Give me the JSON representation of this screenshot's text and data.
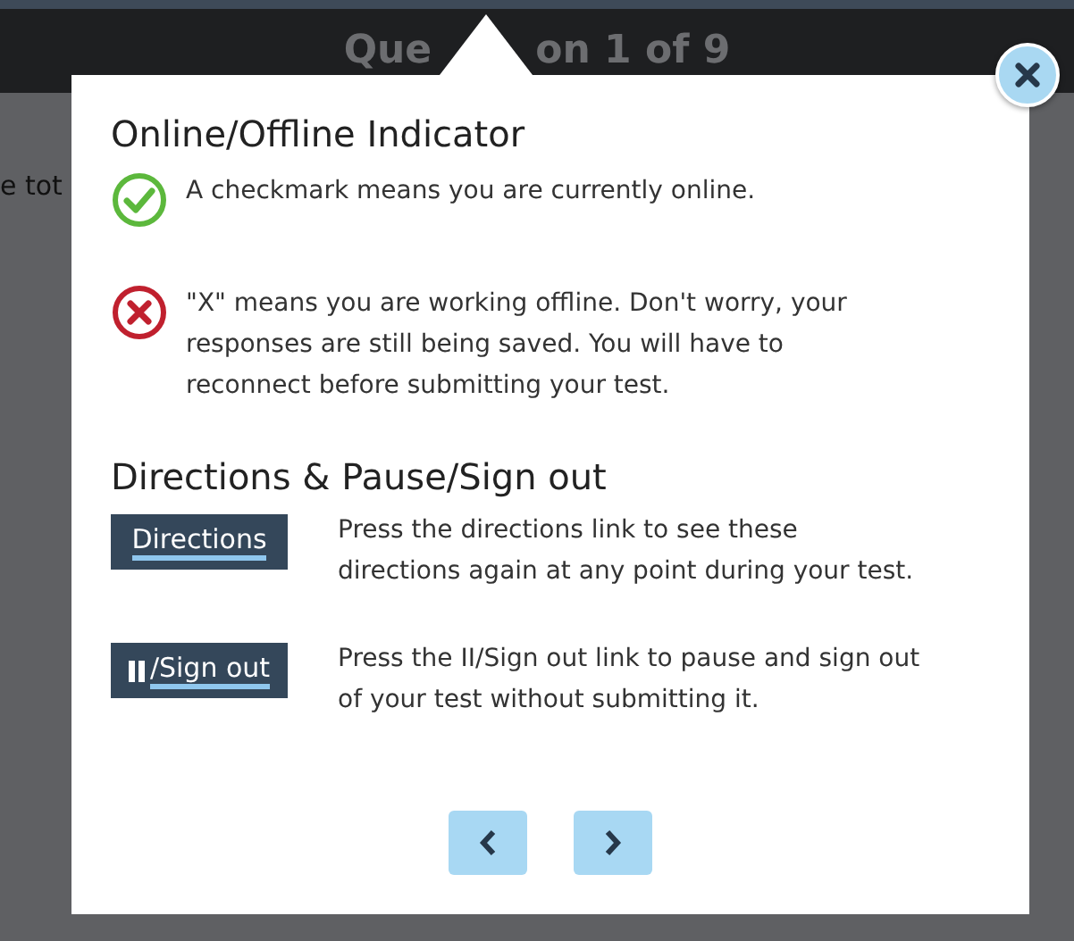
{
  "header": {
    "title_parts": [
      "Que",
      "on 1 of 9"
    ]
  },
  "background_text": "e tot",
  "dialog": {
    "sections": [
      {
        "heading": "Online/Offline Indicator",
        "items": [
          {
            "kind": "online",
            "text": "A checkmark means you are currently online."
          },
          {
            "kind": "offline",
            "text": "\"X\" means you are working offline. Don't worry, your responses are still being saved. You will have to reconnect before submitting your test."
          }
        ]
      },
      {
        "heading": "Directions & Pause/Sign out",
        "items": [
          {
            "kind": "link",
            "label": "Directions",
            "text": "Press the directions link to see these directions again at any point during your test."
          },
          {
            "kind": "pause_link",
            "label": "/Sign out",
            "text": "Press the II/Sign out link to pause and sign out of your test without submitting it."
          }
        ]
      }
    ]
  }
}
